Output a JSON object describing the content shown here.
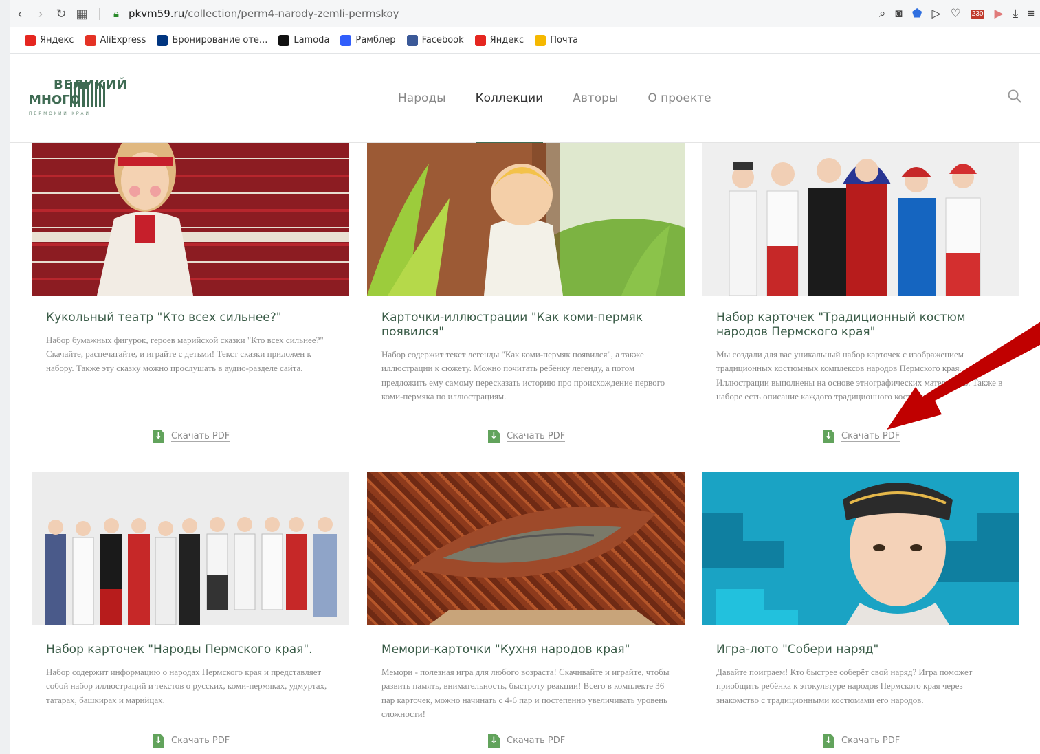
{
  "browser": {
    "url_host": "pkvm59.ru",
    "url_path": "/collection/perm4-narody-zemli-permskoy",
    "download_badge": "230",
    "bookmarks": [
      {
        "label": "Яндекс",
        "icon": "yandex-icon",
        "color": "#e52620"
      },
      {
        "label": "AliExpress",
        "icon": "aliexpress-icon",
        "color": "#e43225"
      },
      {
        "label": "Бронирование оте...",
        "icon": "booking-icon",
        "color": "#003580"
      },
      {
        "label": "Lamoda",
        "icon": "lamoda-icon",
        "color": "#111111"
      },
      {
        "label": "Рамблер",
        "icon": "rambler-icon",
        "color": "#315efb"
      },
      {
        "label": "Facebook",
        "icon": "facebook-icon",
        "color": "#3b5998"
      },
      {
        "label": "Яндекс",
        "icon": "yandex-browser-icon",
        "color": "#e52620"
      },
      {
        "label": "Почта",
        "icon": "mail-icon",
        "color": "#f5b800"
      }
    ]
  },
  "site": {
    "logo_line1": "ВЕЛИКИЙ",
    "logo_line2": "МНОГО",
    "logo_line3": "ПЕРМСКИЙ КРАЙ",
    "menu": [
      {
        "label": "Народы",
        "active": false
      },
      {
        "label": "Коллекции",
        "active": true
      },
      {
        "label": "Авторы",
        "active": false
      },
      {
        "label": "О проекте",
        "active": false
      }
    ],
    "accent_color": "#3f6b53"
  },
  "cards": [
    {
      "title": "Кукольный театр \"Кто всех сильнее?\"",
      "description": "Набор бумажных фигурок, героев марийской сказки \"Кто всех сильнее?\" Скачайте, распечатайте, и играйте с детьми! Текст сказки приложен к набору. Также эту сказку можно прослушать в аудио-разделе сайта.",
      "download": "Скачать PDF"
    },
    {
      "title": "Карточки-иллюстрации \"Как коми-пермяк появился\"",
      "description": "Набор содержит текст легенды \"Как коми-пермяк появился\", а также иллюстрации к сюжету. Можно почитать ребёнку легенду, а потом предложить ему самому пересказать историю про происхождение первого коми-пермяка по иллюстрациям.",
      "download": "Скачать PDF"
    },
    {
      "title": "Набор карточек \"Традиционный костюм народов Пермского края\"",
      "description": "Мы создали для вас уникальный набор карточек с изображением традиционных костюмных комплексов народов Пермского края. Иллюстрации выполнены на основе этнографических материалов. Также в наборе есть описание каждого традиционного костюма.",
      "download": "Скачать PDF"
    },
    {
      "title": "Набор карточек \"Народы Пермского края\".",
      "description": "Набор содержит информацию о народах Пермского края и представляет собой набор иллюстраций и текстов о русских, коми-пермяках, удмуртах, татарах, башкирах и марийцах.",
      "download": "Скачать PDF"
    },
    {
      "title": "Мемори-карточки \"Кухня народов края\"",
      "description": "Мемори - полезная игра для любого возраста! Скачивайте и играйте, чтобы развить память, внимательность, быстроту реакции! Всего в комплекте 36 пар карточек, можно начинать с 4-6 пар и постепенно увеличивать уровень сложности!",
      "download": "Скачать PDF"
    },
    {
      "title": "Игра-лото \"Собери наряд\"",
      "description": "Давайте поиграем! Кто быстрее соберёт свой наряд? Игра поможет приобщить ребёнка к этокультуре народов Пермского края через знакомство с традиционными костюмами его народов.",
      "download": "Скачать PDF"
    }
  ]
}
